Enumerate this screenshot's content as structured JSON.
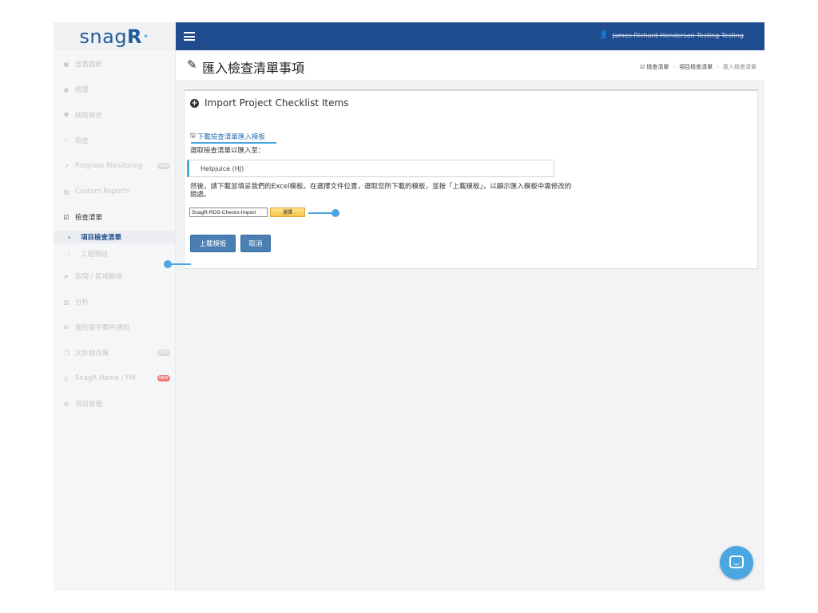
{
  "logo": {
    "text": "snag",
    "accent": "R"
  },
  "sidebar": {
    "items": [
      {
        "icon": "image-icon",
        "glyph": "▣",
        "label": "查看圖紙"
      },
      {
        "icon": "dashboard-icon",
        "glyph": "◉",
        "label": "總覽"
      },
      {
        "icon": "map-marker-icon",
        "glyph": "♥",
        "label": "缺陷報告"
      },
      {
        "icon": "search-icon",
        "glyph": "⌕",
        "label": "檢查"
      },
      {
        "icon": "chart-line-icon",
        "glyph": "↗",
        "label": "Progress Monitoring",
        "badge": "NEW"
      },
      {
        "icon": "document-icon",
        "glyph": "▤",
        "label": "Custom Reports"
      },
      {
        "icon": "checkbox-icon",
        "glyph": "☑",
        "label": "檢查清單",
        "active": true
      },
      {
        "icon": "send-icon",
        "glyph": "➤",
        "label": "房間 / 區域驗收"
      },
      {
        "icon": "bar-chart-icon",
        "glyph": "▥",
        "label": "分析"
      },
      {
        "icon": "envelope-icon",
        "glyph": "✉",
        "label": "我的電子郵件通知"
      },
      {
        "icon": "copy-icon",
        "glyph": "❐",
        "label": "文件儲存庫",
        "badge": "NEW"
      },
      {
        "icon": "file-icon",
        "glyph": "▯",
        "label": "SnagR Home / FM",
        "badge": "NEW",
        "badge_red": true
      },
      {
        "icon": "gears-icon",
        "glyph": "⚙",
        "label": "項目管理"
      }
    ],
    "sub_items": [
      {
        "label": "項目檢查清單",
        "current": true
      },
      {
        "label": "工程階段",
        "current": false
      }
    ]
  },
  "topbar": {
    "user_name": "James Richard Henderson Testing Testing"
  },
  "page": {
    "title": "匯入檢查清單事項",
    "breadcrumb": [
      "檢查清單",
      "項目檢查清單",
      "匯入檢查清單"
    ]
  },
  "panel": {
    "title": "Import Project Checklist Items",
    "download_link": "下載檢查清單匯入模板",
    "select_label": "選取檢查清單以匯入至：",
    "select_value": "Helpjuice (HJ)",
    "instructions": "然後，請下載並填妥我們的Excel模板。在選擇文件位置，選取您所下載的模板，並按「上載模板」，以顯示匯入模板中需修改的錯處。",
    "file_name": "SnagR-RDS-Checks-Import",
    "file_button": "選擇",
    "upload_button": "上載模板",
    "cancel_button": "取消"
  },
  "colors": {
    "brand": "#1f4b8f",
    "accent": "#4aa7e2",
    "button": "#4a7fb3"
  }
}
